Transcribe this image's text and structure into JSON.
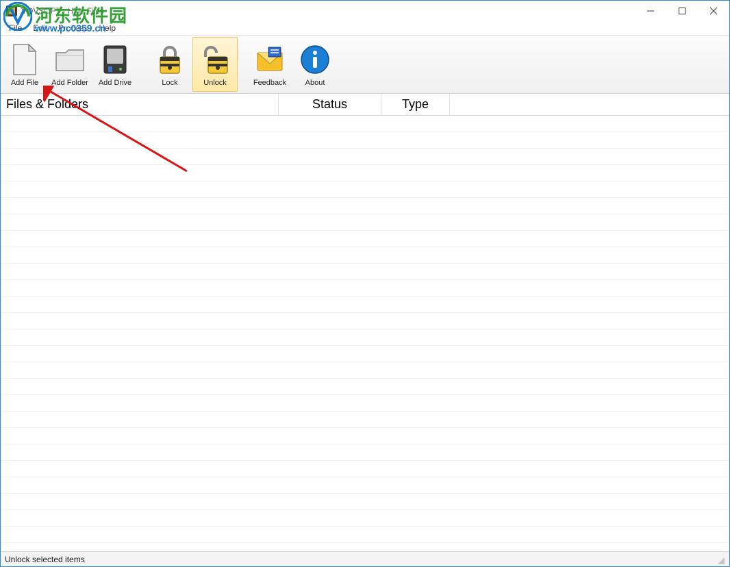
{
  "window": {
    "title": "VOVSOFT - Hide Files"
  },
  "menu": {
    "items": [
      "File",
      "Edit",
      "Process",
      "Help"
    ]
  },
  "toolbar": {
    "add_file": {
      "label": "Add File"
    },
    "add_folder": {
      "label": "Add Folder"
    },
    "add_drive": {
      "label": "Add Drive"
    },
    "lock": {
      "label": "Lock"
    },
    "unlock": {
      "label": "Unlock",
      "selected": true
    },
    "feedback": {
      "label": "Feedback"
    },
    "about": {
      "label": "About"
    }
  },
  "columns": {
    "files": "Files & Folders",
    "status": "Status",
    "type": "Type"
  },
  "statusbar": {
    "text": "Unlock selected items"
  },
  "watermark": {
    "cn": "河东软件园",
    "url": "www.pc0359.cn"
  }
}
